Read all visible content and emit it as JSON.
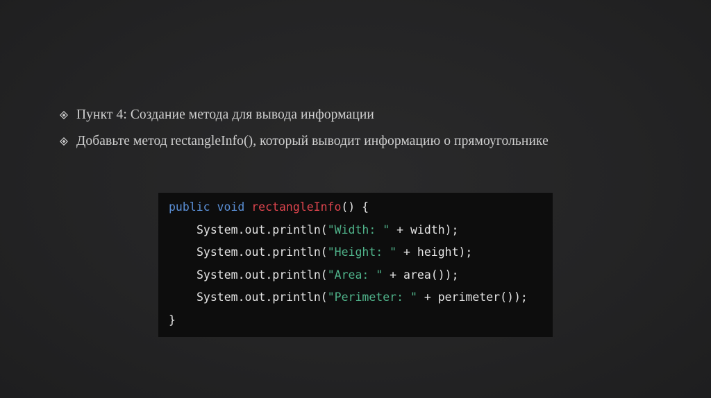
{
  "slide": {
    "bullets": [
      {
        "icon": "diamond-bullet-icon",
        "text": "Пункт 4: Создание метода для вывода информации"
      },
      {
        "icon": "diamond-bullet-icon",
        "text": "Добавьте метод rectangleInfo(), который выводит информацию о прямоугольнике"
      }
    ],
    "code": {
      "line1": {
        "kw1": "public",
        "kw2": "void",
        "fn": "rectangleInfo",
        "rest": "() {"
      },
      "line2": {
        "call": "System.out.println(",
        "str": "\"Width: \"",
        "rest": " + width);"
      },
      "line3": {
        "call": "System.out.println(",
        "str": "\"Height: \"",
        "rest": " + height);"
      },
      "line4": {
        "call": "System.out.println(",
        "str": "\"Area: \"",
        "rest": " + area());"
      },
      "line5": {
        "call": "System.out.println(",
        "str": "\"Perimeter: \"",
        "rest": " + perimeter());"
      },
      "line6": {
        "text": "}"
      }
    },
    "colors": {
      "background": "#242425",
      "text": "#cfcfcf",
      "code_background": "#0d0d0d",
      "keyword": "#5a8fd6",
      "function_name": "#e0454e",
      "string": "#4fb38a"
    }
  }
}
